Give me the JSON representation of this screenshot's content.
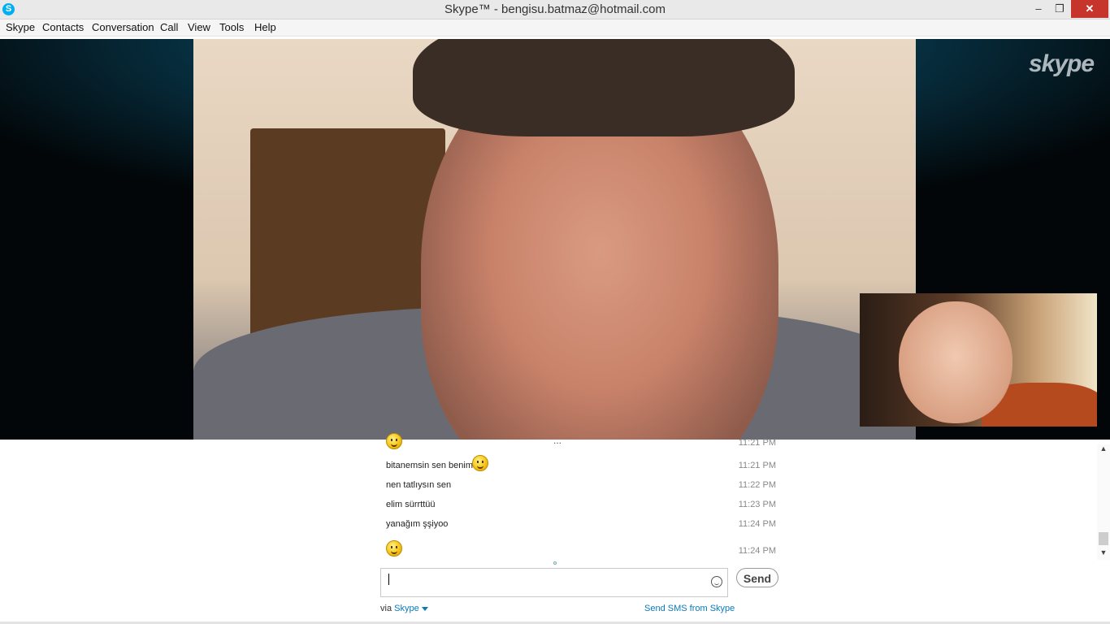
{
  "window": {
    "title": "Skype™ - bengisu.batmaz@hotmail.com",
    "app_icon_glyph": "S",
    "min_glyph": "–",
    "max_glyph": "❐",
    "close_glyph": "✕"
  },
  "menu": {
    "items": [
      "Skype",
      "Contacts",
      "Conversation",
      "Call",
      "View",
      "Tools",
      "Help"
    ]
  },
  "video": {
    "watermark": "skype"
  },
  "chat": {
    "overflow_dots": "...",
    "messages": [
      {
        "text": "",
        "emoticon": true,
        "time": "11:21 PM"
      },
      {
        "text": "bitanemsin sen benim",
        "emoticon": true,
        "time": "11:21 PM"
      },
      {
        "text": "nen tatlıysın sen",
        "emoticon": false,
        "time": "11:22 PM"
      },
      {
        "text": "elim sürrttüü",
        "emoticon": false,
        "time": "11:23 PM"
      },
      {
        "text": "yanağım şşiyoo",
        "emoticon": false,
        "time": "11:24 PM"
      },
      {
        "text": "",
        "emoticon": true,
        "time": "11:24 PM"
      }
    ],
    "input_value": "",
    "send_label": "Send",
    "via_label": "via",
    "via_link": "Skype",
    "sms_link": "Send SMS from Skype"
  },
  "colors": {
    "accent": "#00aff0",
    "link": "#0a7ab8",
    "close_button": "#c7342b"
  }
}
